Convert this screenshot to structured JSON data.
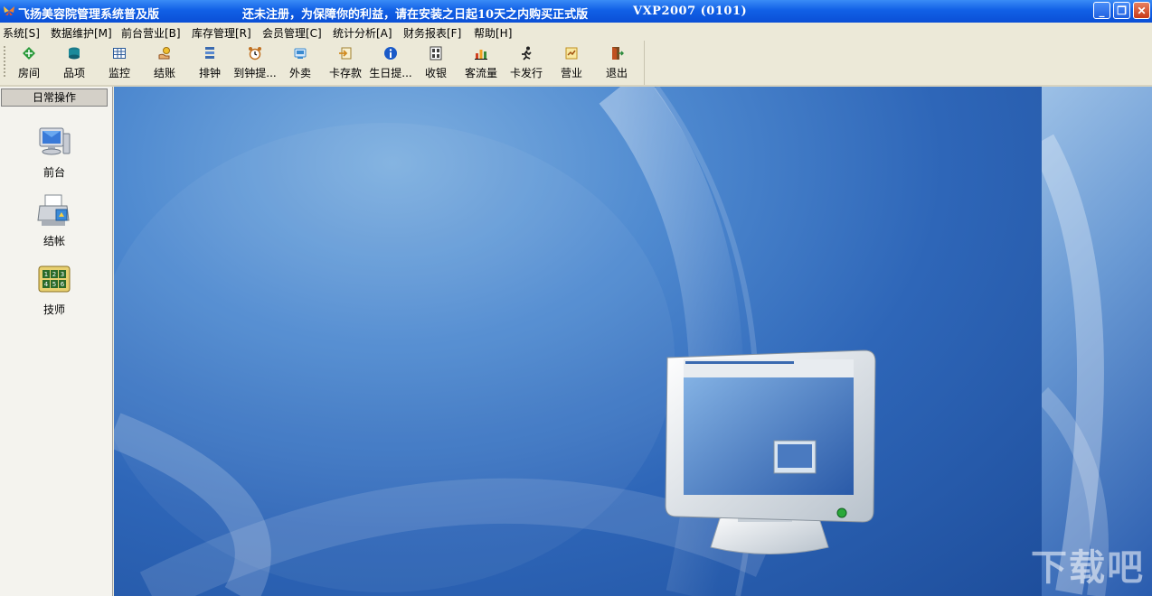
{
  "window": {
    "title": "飞扬美容院管理系统普及版",
    "notice": "还未注册，为保障你的利益，请在安装之日起10天之内购买正式版",
    "version": "VXP2007 (0101)",
    "buttons": {
      "minimize": "_",
      "restore": "❐",
      "close": "✕"
    }
  },
  "menu": [
    {
      "label": "系统[S]"
    },
    {
      "label": "数据维护[M]"
    },
    {
      "label": "前台营业[B]"
    },
    {
      "label": "库存管理[R]"
    },
    {
      "label": "会员管理[C]"
    },
    {
      "label": "统计分析[A]"
    },
    {
      "label": "财务报表[F]"
    },
    {
      "label": "帮助[H]"
    }
  ],
  "toolbar": [
    {
      "label": "房间",
      "icon": "room-icon",
      "color": "#2a9a3a"
    },
    {
      "label": "品项",
      "icon": "database-icon",
      "color": "#1a7a8a"
    },
    {
      "label": "监控",
      "icon": "grid-monitor-icon",
      "color": "#2a5a9a"
    },
    {
      "label": "结账",
      "icon": "hand-coin-icon",
      "color": "#d0a020"
    },
    {
      "label": "排钟",
      "icon": "schedule-list-icon",
      "color": "#3a6ab0"
    },
    {
      "label": "到钟提...",
      "icon": "alarm-clock-icon",
      "color": "#c07020"
    },
    {
      "label": "外卖",
      "icon": "takeout-icon",
      "color": "#3a8ad0"
    },
    {
      "label": "卡存款",
      "icon": "card-deposit-icon",
      "color": "#d08a20"
    },
    {
      "label": "生日提...",
      "icon": "info-icon",
      "color": "#1a5ac8"
    },
    {
      "label": "收银",
      "icon": "cashier-icon",
      "color": "#404040"
    },
    {
      "label": "客流量",
      "icon": "bar-chart-icon",
      "color": "#d04020"
    },
    {
      "label": "卡发行",
      "icon": "runner-icon",
      "color": "#202020"
    },
    {
      "label": "营业",
      "icon": "business-icon",
      "color": "#c09020"
    },
    {
      "label": "退出",
      "icon": "exit-door-icon",
      "color": "#c05020"
    }
  ],
  "sidebar": {
    "header": "日常操作",
    "items": [
      {
        "label": "前台",
        "icon": "computer-icon"
      },
      {
        "label": "结帐",
        "icon": "printer-icon"
      },
      {
        "label": "技师",
        "icon": "number-pad-icon"
      }
    ]
  },
  "watermark": "下载吧",
  "colors": {
    "titlebar": "#1160e6",
    "desktop": "#2e66b8",
    "chrome": "#ece9d8"
  }
}
